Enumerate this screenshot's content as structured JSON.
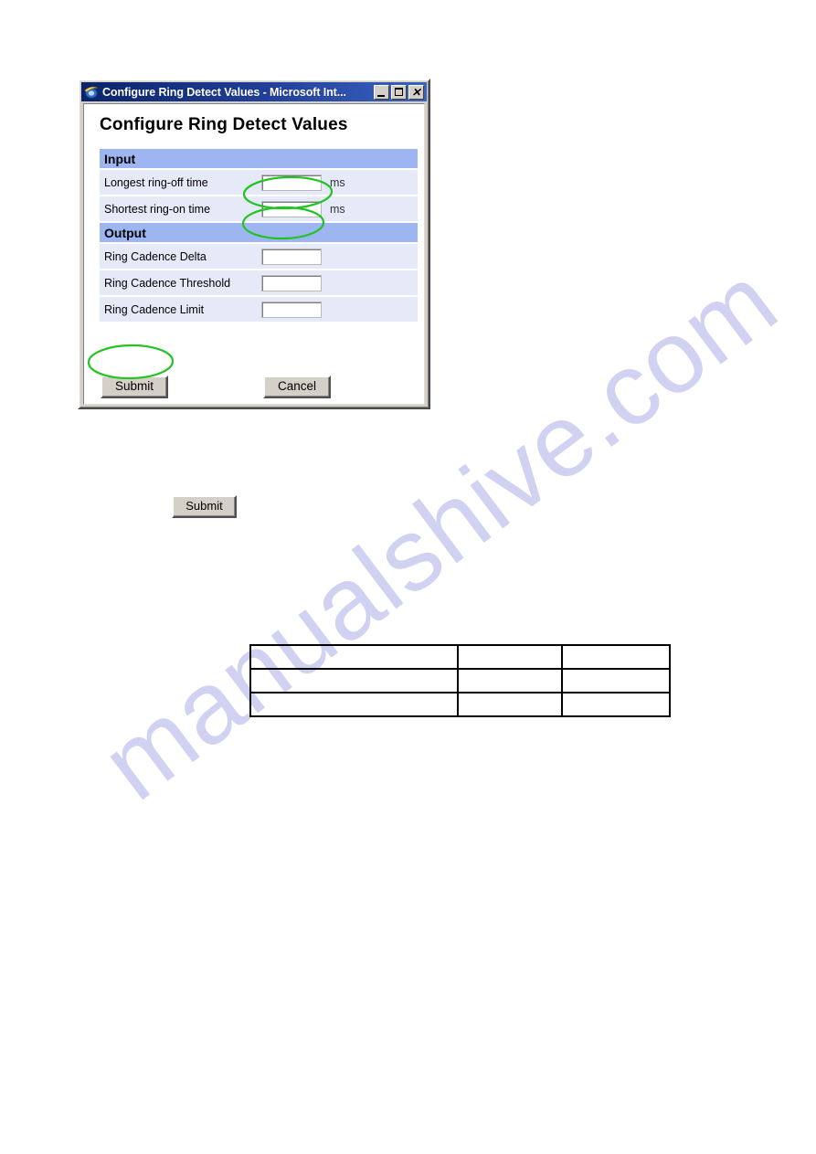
{
  "window": {
    "title": "Configure Ring Detect Values - Microsoft Int...",
    "icon": "internet-explorer-icon",
    "controls": {
      "minimize": "_",
      "maximize": "□",
      "close": "✕"
    }
  },
  "page": {
    "heading": "Configure Ring Detect Values"
  },
  "form": {
    "sections": [
      {
        "header": "Input",
        "rows": [
          {
            "label": "Longest  ring-off time",
            "value": "",
            "unit": "ms"
          },
          {
            "label": "Shortest ring-on time",
            "value": "",
            "unit": "ms"
          }
        ]
      },
      {
        "header": "Output",
        "rows": [
          {
            "label": "Ring Cadence Delta",
            "value": "",
            "unit": ""
          },
          {
            "label": "Ring Cadence Threshold",
            "value": "",
            "unit": ""
          },
          {
            "label": "Ring Cadence Limit",
            "value": "",
            "unit": ""
          }
        ]
      }
    ],
    "buttons": {
      "submit": "Submit",
      "cancel": "Cancel"
    }
  },
  "standalone_button": {
    "submit": "Submit"
  },
  "blank_table": {
    "rows": [
      [
        "",
        "",
        ""
      ],
      [
        "",
        "",
        ""
      ],
      [
        "",
        "",
        ""
      ]
    ]
  },
  "watermark": {
    "text": "manualshive.com"
  },
  "colors": {
    "titlebar": "#0a246a",
    "section_header": "#9db6f2",
    "field_row": "#e6e9f8",
    "annotation": "#22c322",
    "button_face": "#d4d0c8",
    "watermark": "#c9cbf0"
  }
}
